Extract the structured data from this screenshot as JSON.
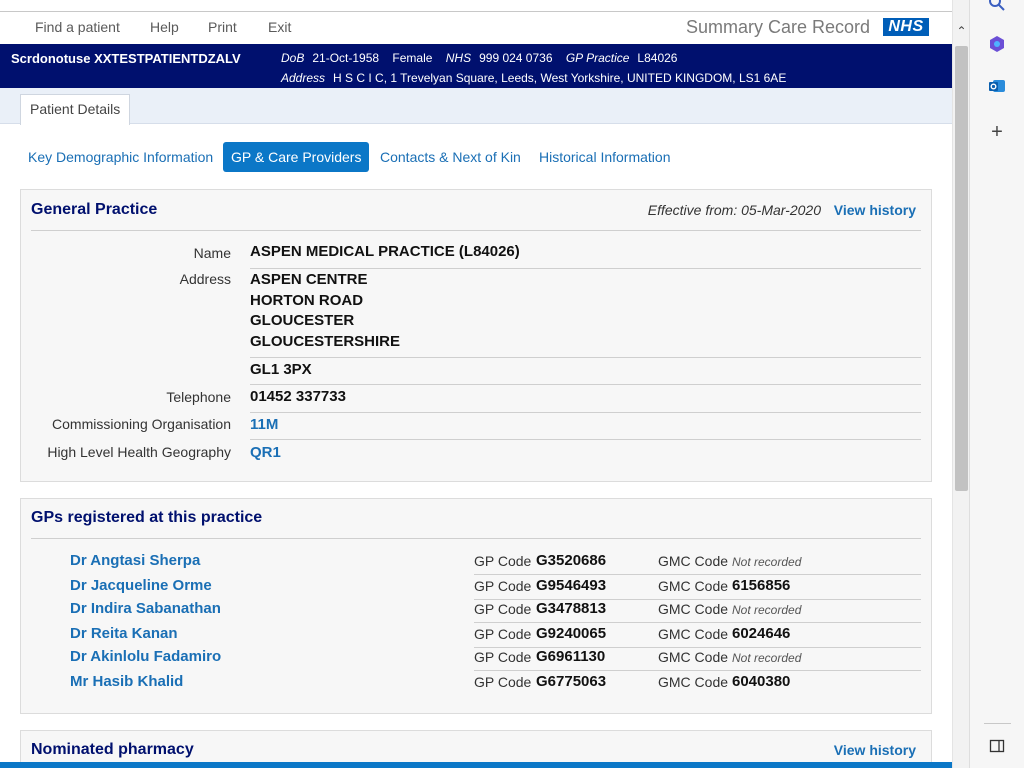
{
  "topnav": {
    "find_patient": "Find a patient",
    "help": "Help",
    "print": "Print",
    "exit": "Exit",
    "app_title": "Summary Care Record",
    "logo_text": "NHS"
  },
  "patient": {
    "name": "Scrdonotuse XXTESTPATIENTDZALV",
    "dob_label": "DoB",
    "dob": "21-Oct-1958",
    "gender": "Female",
    "nhs_label": "NHS",
    "nhs_number": "999 024 0736",
    "gp_practice_label": "GP Practice",
    "gp_practice": "L84026",
    "address_label": "Address",
    "address": "H S C I C, 1 Trevelyan Square, Leeds, West Yorkshire, UNITED KINGDOM, LS1 6AE"
  },
  "tabs": {
    "active": "Patient Details"
  },
  "subnav": {
    "items": [
      {
        "label": "Key Demographic Information"
      },
      {
        "label": "GP & Care Providers"
      },
      {
        "label": "Contacts & Next of Kin"
      },
      {
        "label": "Historical Information"
      }
    ]
  },
  "general_practice": {
    "title": "General Practice",
    "effective": "Effective from: 05-Mar-2020",
    "view_history": "View history",
    "name_label": "Name",
    "name": "ASPEN MEDICAL PRACTICE (L84026)",
    "address_label": "Address",
    "address_lines": [
      "ASPEN CENTRE",
      "HORTON ROAD",
      "GLOUCESTER",
      "GLOUCESTERSHIRE"
    ],
    "postcode": "GL1 3PX",
    "telephone_label": "Telephone",
    "telephone": "01452 337733",
    "commissioning_label": "Commissioning Organisation",
    "commissioning": "11M",
    "geography_label": "High Level Health Geography",
    "geography": "QR1"
  },
  "gps": {
    "title": "GPs registered at this practice",
    "gp_code_label": "GP Code",
    "gmc_code_label": "GMC Code",
    "rows": [
      {
        "name": "Dr Angtasi Sherpa",
        "gp_code": "G3520686",
        "gmc_code": "Not recorded"
      },
      {
        "name": "Dr Jacqueline Orme",
        "gp_code": "G9546493",
        "gmc_code": "6156856"
      },
      {
        "name": "Dr Indira Sabanathan",
        "gp_code": "G3478813",
        "gmc_code": "Not recorded"
      },
      {
        "name": "Dr Reita Kanan",
        "gp_code": "G9240065",
        "gmc_code": "6024646"
      },
      {
        "name": "Dr Akinlolu Fadamiro",
        "gp_code": "G6961130",
        "gmc_code": "Not recorded"
      },
      {
        "name": "Mr Hasib Khalid",
        "gp_code": "G6775063",
        "gmc_code": "6040380"
      }
    ]
  },
  "pharmacy": {
    "title": "Nominated pharmacy",
    "view_history": "View history"
  },
  "sidepanel": {
    "icons": [
      "search-icon",
      "copilot-icon",
      "outlook-icon",
      "add-icon",
      "sidebar-toggle-icon"
    ]
  },
  "colors": {
    "banner": "#00106e",
    "link": "#1a6fb5",
    "active_tab": "#0b77c7",
    "nhs_blue": "#005eb8"
  }
}
